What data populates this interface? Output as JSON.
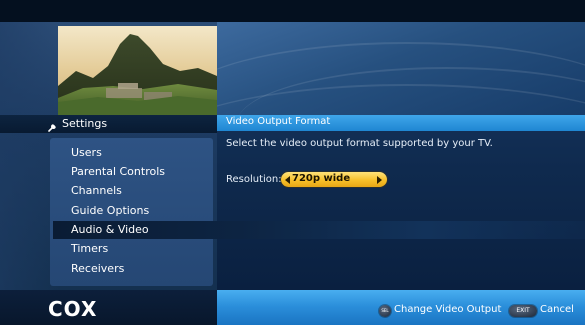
{
  "sidebar": {
    "title": "Settings",
    "items": [
      {
        "label": "Users"
      },
      {
        "label": "Parental Controls"
      },
      {
        "label": "Channels"
      },
      {
        "label": "Guide Options"
      },
      {
        "label": "Audio & Video"
      },
      {
        "label": "Timers"
      },
      {
        "label": "Receivers"
      }
    ],
    "selected_item": "Audio & Video"
  },
  "panel": {
    "title": "Video Output Format",
    "instruction": "Select the video output format supported by your TV.",
    "resolution_label": "Resolution:",
    "resolution_value": "720p wide"
  },
  "footer": {
    "logo": "COX",
    "sel_key": "SEL",
    "sel_action": "Change Video Output",
    "exit_key": "EXIT",
    "exit_action": "Cancel"
  },
  "colors": {
    "title_bar": "#2b95de",
    "footer_bar": "#2b8fdb",
    "selector_pill": "#f7c02a"
  },
  "icons": {
    "settings": "settings-wrench-icon",
    "left_arrow": "left-arrow-icon",
    "right_arrow": "right-arrow-icon"
  }
}
